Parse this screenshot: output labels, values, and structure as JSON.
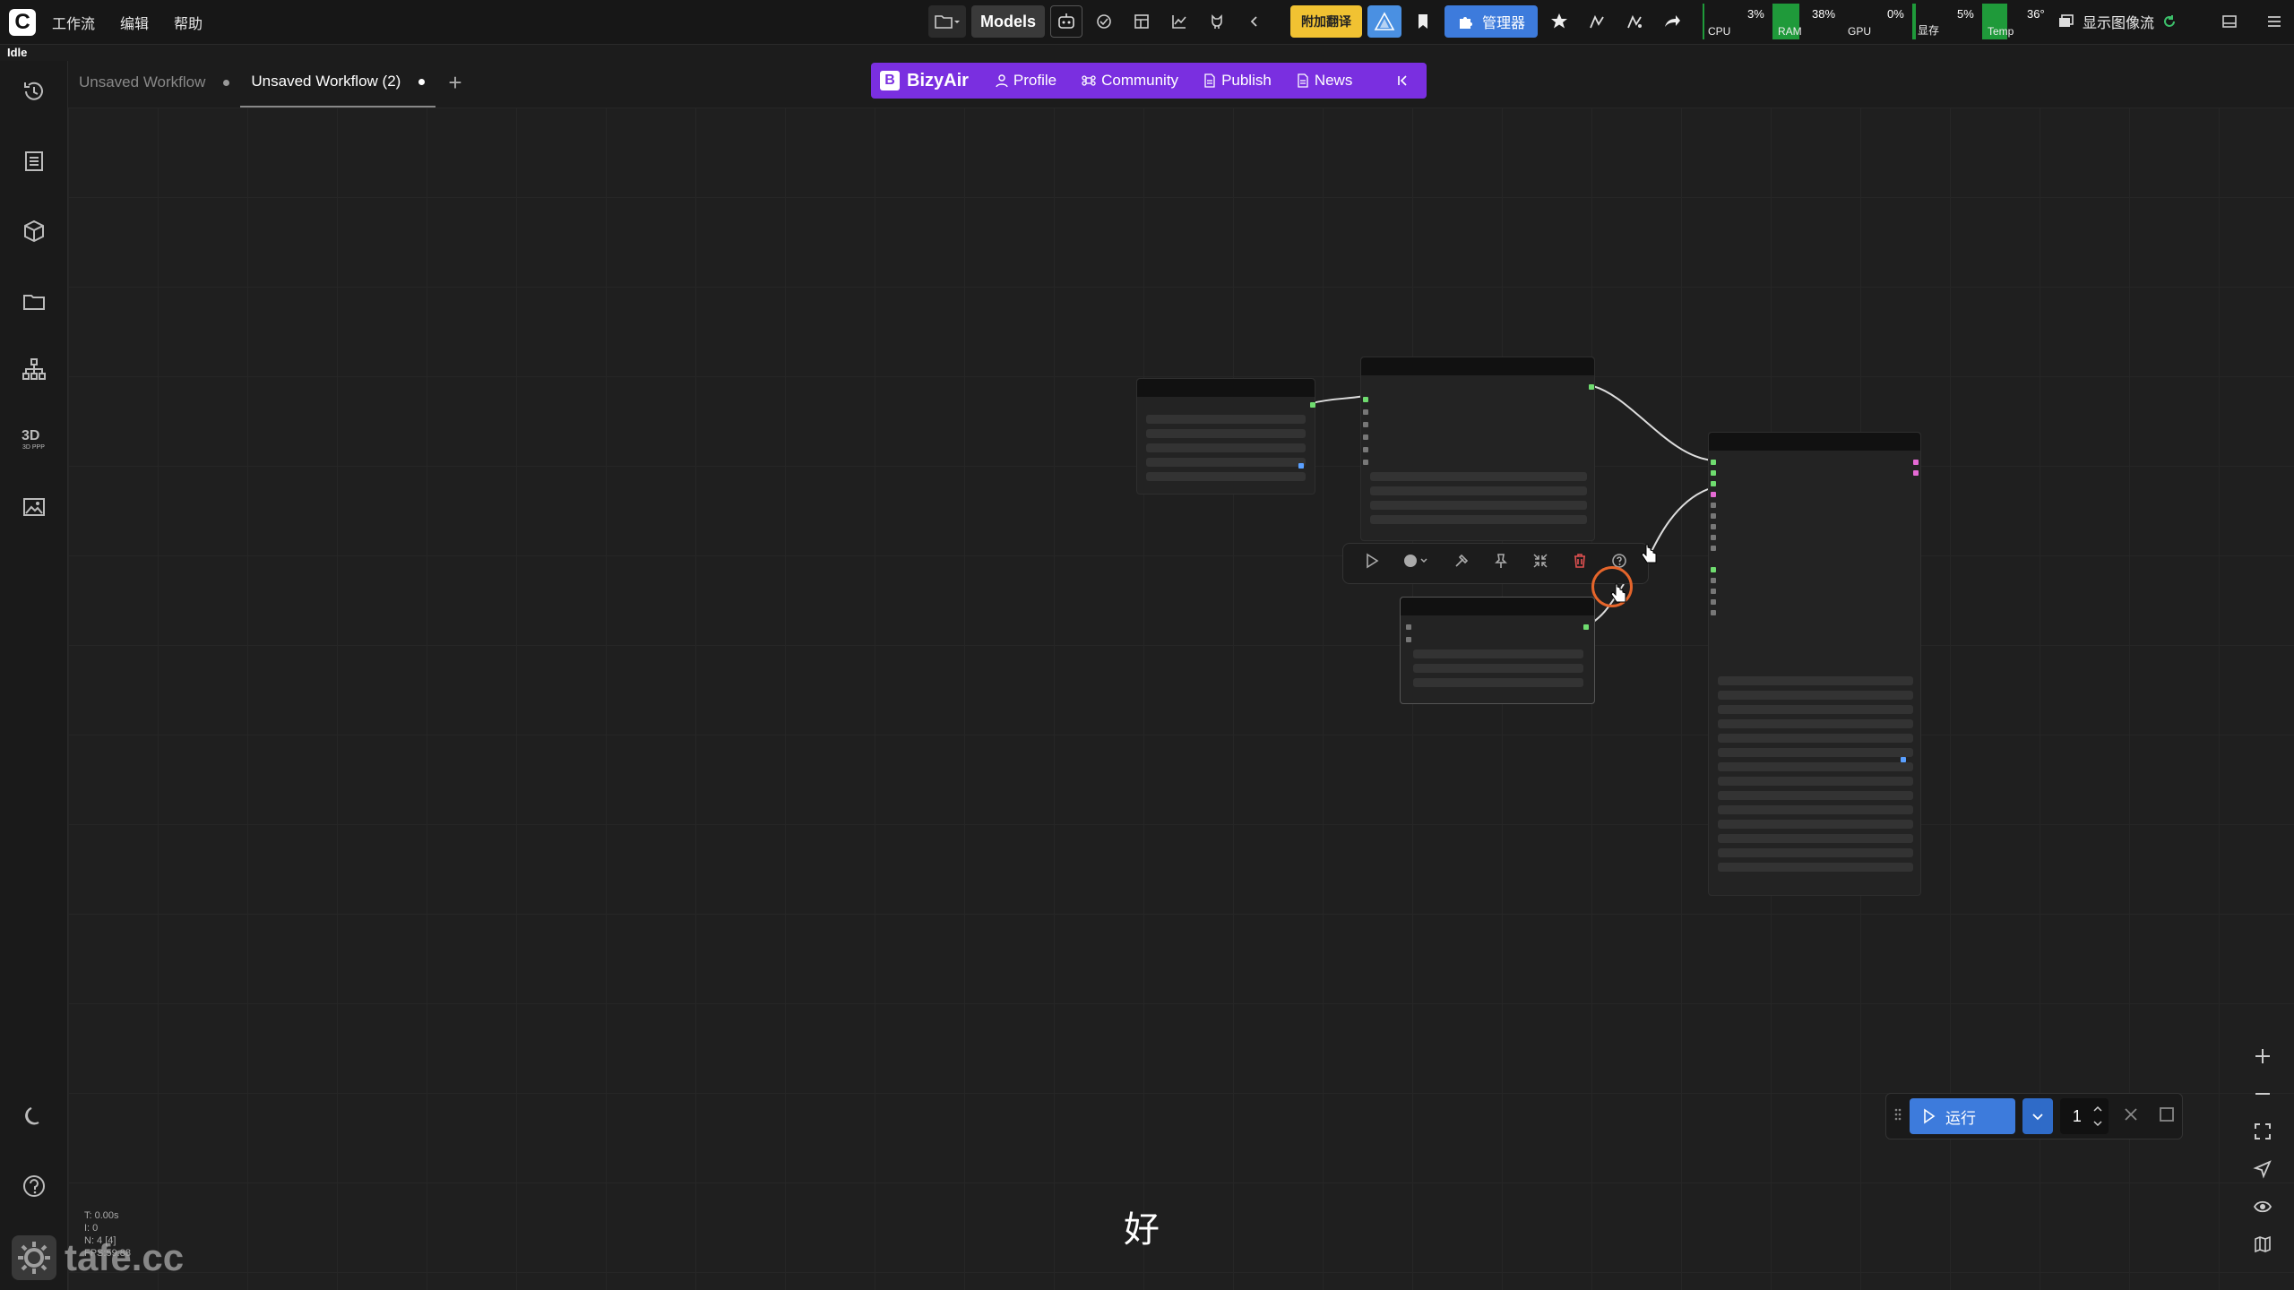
{
  "app": {
    "logo": "C",
    "status": "Idle"
  },
  "menu": [
    "工作流",
    "编辑",
    "帮助"
  ],
  "toolbar": {
    "models_label": "Models",
    "translate_label": "附加翻译",
    "manager_label": "管理器",
    "show_flow_label": "显示图像流"
  },
  "monitor": {
    "cpu": {
      "label": "CPU",
      "value": "3%"
    },
    "ram": {
      "label": "RAM",
      "value": "38%"
    },
    "gpu": {
      "label": "GPU",
      "value": "0%"
    },
    "vram": {
      "label": "显存",
      "value": "5%"
    },
    "temp": {
      "label": "Temp",
      "value": "36°"
    }
  },
  "tabs": [
    {
      "label": "Unsaved Workflow",
      "active": false
    },
    {
      "label": "Unsaved Workflow (2)",
      "active": true
    }
  ],
  "bizyair": {
    "brand": "BizyAir",
    "items": [
      "Profile",
      "Community",
      "Publish",
      "News"
    ]
  },
  "run": {
    "label": "运行",
    "count": "1"
  },
  "stats": [
    "T: 0.00s",
    "I: 0",
    "N: 4 [4]",
    "FPS:59.88"
  ],
  "watermark": "tafe.cc",
  "subtitle": "好",
  "colors": {
    "accent": "#3d7bdc",
    "bizyair": "#7a2fe0",
    "delete": "#e05050",
    "cursor_ring": "#e5652b"
  }
}
